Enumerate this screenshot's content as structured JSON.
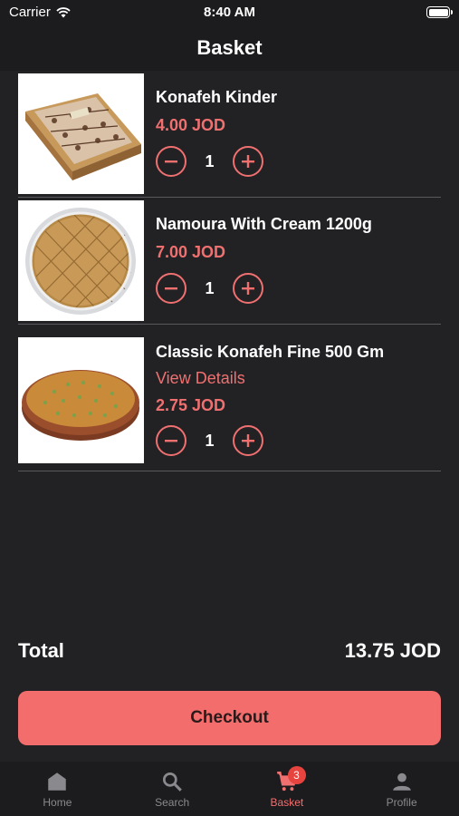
{
  "status_bar": {
    "carrier": "Carrier",
    "time": "8:40 AM"
  },
  "header": {
    "title": "Basket"
  },
  "items": [
    {
      "name": "Konafeh Kinder",
      "price": "4.00 JOD",
      "quantity": "1",
      "image_icon": "konafeh-kinder-image"
    },
    {
      "name": "Namoura With Cream 1200g",
      "price": "7.00 JOD",
      "quantity": "1",
      "image_icon": "namoura-image"
    },
    {
      "name": "Classic Konafeh Fine 500 Gm",
      "details_link": "View Details",
      "price": "2.75 JOD",
      "quantity": "1",
      "image_icon": "classic-konafeh-image"
    }
  ],
  "summary": {
    "total_label": "Total",
    "total_value": "13.75 JOD"
  },
  "checkout": {
    "label": "Checkout"
  },
  "tabs": [
    {
      "label": "Home",
      "icon": "home-icon"
    },
    {
      "label": "Search",
      "icon": "search-icon"
    },
    {
      "label": "Basket",
      "icon": "cart-icon",
      "badge": "3",
      "active": true
    },
    {
      "label": "Profile",
      "icon": "person-icon"
    }
  ],
  "colors": {
    "accent": "#f07070",
    "checkout_bg": "#f46d6d",
    "background": "#222225",
    "bar_bg": "#1c1c1e",
    "badge": "#e8443f"
  }
}
